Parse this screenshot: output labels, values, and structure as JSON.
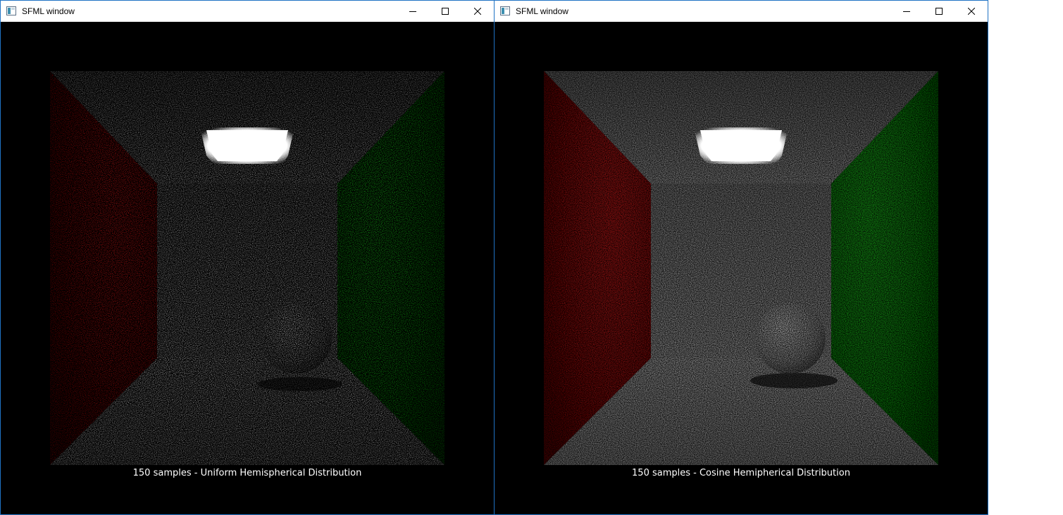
{
  "windows": [
    {
      "title": "SFML window",
      "caption": "150 samples - Uniform Hemispherical Distribution",
      "sampling": "uniform"
    },
    {
      "title": "SFML window",
      "caption": "150 samples - Cosine Hemipherical Distribution",
      "sampling": "cosine"
    }
  ],
  "controls": {
    "minimize_icon": "minimize-icon",
    "maximize_icon": "maximize-icon",
    "close_icon": "close-icon"
  },
  "colors": {
    "left_wall": "#a01010",
    "right_wall": "#109010",
    "walls": "#9a9a9a",
    "light": "#ffffff",
    "window_border": "#1f72c4"
  }
}
